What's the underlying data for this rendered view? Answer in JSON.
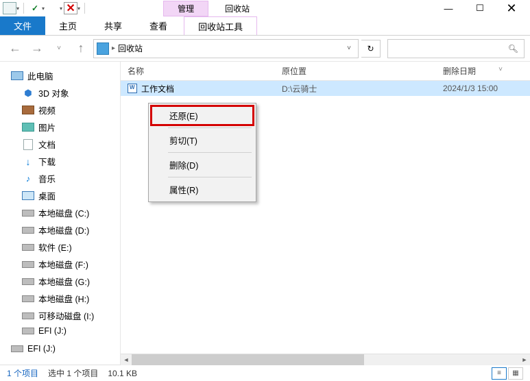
{
  "window": {
    "title": "回收站",
    "manage_tab": "管理"
  },
  "ribbon": {
    "file": "文件",
    "home": "主页",
    "share": "共享",
    "view": "查看",
    "tools": "回收站工具"
  },
  "nav": {
    "path": "回收站"
  },
  "columns": {
    "name": "名称",
    "location": "原位置",
    "deleted": "删除日期"
  },
  "sidebar": {
    "pc": "此电脑",
    "items": [
      "3D 对象",
      "视频",
      "图片",
      "文档",
      "下载",
      "音乐",
      "桌面",
      "本地磁盘 (C:)",
      "本地磁盘 (D:)",
      "软件 (E:)",
      "本地磁盘 (F:)",
      "本地磁盘 (G:)",
      "本地磁盘 (H:)",
      "可移动磁盘 (I:)",
      "EFI (J:)"
    ],
    "extra": "EFI (J:)"
  },
  "file": {
    "name": "工作文档",
    "location": "D:\\云骑士",
    "deleted": "2024/1/3 15:00"
  },
  "context_menu": {
    "restore": "还原(E)",
    "cut": "剪切(T)",
    "delete": "删除(D)",
    "properties": "属性(R)"
  },
  "status": {
    "count": "1 个项目",
    "selected": "选中 1 个项目",
    "size": "10.1 KB"
  }
}
